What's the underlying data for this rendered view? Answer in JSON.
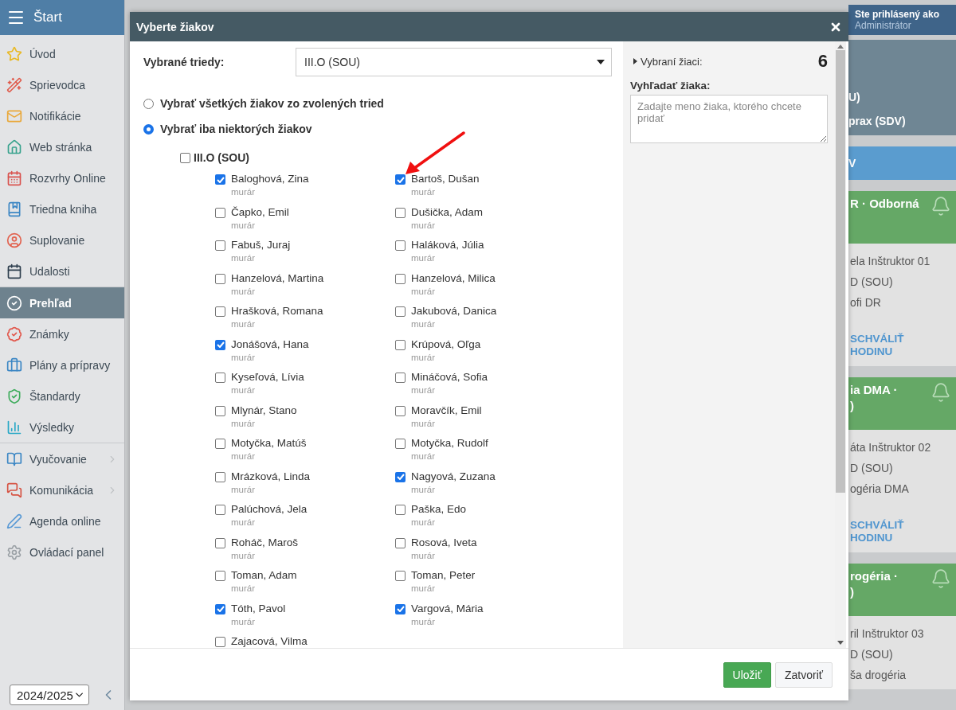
{
  "topbar": {
    "title": "Štart"
  },
  "sidebar": {
    "groups": [
      {
        "items": [
          {
            "label": "Úvod",
            "selected": false,
            "has_submenu": false
          },
          {
            "label": "Sprievodca",
            "selected": false,
            "has_submenu": false
          },
          {
            "label": "Notifikácie",
            "selected": false,
            "has_submenu": false
          },
          {
            "label": "Web stránka",
            "selected": false,
            "has_submenu": false
          },
          {
            "label": "Rozvrhy Online",
            "selected": false,
            "has_submenu": false
          },
          {
            "label": "Triedna kniha",
            "selected": false,
            "has_submenu": false
          },
          {
            "label": "Suplovanie",
            "selected": false,
            "has_submenu": false
          },
          {
            "label": "Udalosti",
            "selected": false,
            "has_submenu": false
          }
        ]
      },
      {
        "items": [
          {
            "label": "Prehľad",
            "selected": true,
            "has_submenu": false
          },
          {
            "label": "Známky",
            "selected": false,
            "has_submenu": false
          },
          {
            "label": "Plány a prípravy",
            "selected": false,
            "has_submenu": false
          },
          {
            "label": "Štandardy",
            "selected": false,
            "has_submenu": false
          },
          {
            "label": "Výsledky",
            "selected": false,
            "has_submenu": false
          }
        ]
      },
      {
        "items": [
          {
            "label": "Vyučovanie",
            "selected": false,
            "has_submenu": true
          },
          {
            "label": "Komunikácia",
            "selected": false,
            "has_submenu": true
          },
          {
            "label": "Agenda online",
            "selected": false,
            "has_submenu": false
          },
          {
            "label": "Ovládací panel",
            "selected": false,
            "has_submenu": false
          }
        ]
      }
    ],
    "year_select": "2024/2025"
  },
  "user": {
    "caption": "Ste prihlásený ako",
    "name": "Administrátor"
  },
  "cards": [
    {
      "kind": "info",
      "lines": [
        "U)",
        "prax (SDV)"
      ]
    },
    {
      "kind": "banner",
      "lines": [
        "V"
      ]
    },
    {
      "kind": "lesson",
      "title": [
        "R · Odborná"
      ],
      "lines": [
        "ela Inštruktor 01",
        "D (SOU)",
        "ofi DR"
      ],
      "link": "SCHVÁLIŤ HODINU"
    },
    {
      "kind": "lesson",
      "title": [
        "ia DMA ·",
        ")"
      ],
      "lines": [
        "áta Inštruktor 02",
        "D (SOU)",
        "ogéria DMA"
      ],
      "link": "SCHVÁLIŤ HODINU"
    },
    {
      "kind": "lesson",
      "title": [
        "rogéria ·",
        ")"
      ],
      "lines": [
        "ril Inštruktor 03",
        "D (SOU)",
        "ša drogéria"
      ]
    }
  ],
  "dialog": {
    "title": "Vyberte žiakov",
    "class_label": "Vybrané triedy:",
    "class_value": "III.O (SOU)",
    "radios": [
      {
        "label": "Vybrať všetkých žiakov zo zvolených tried",
        "selected": false
      },
      {
        "label": "Vybrať iba niektorých žiakov",
        "selected": true
      }
    ],
    "group": {
      "label": "III.O (SOU)",
      "checked": false
    },
    "students": [
      {
        "name": "Baloghová, Zina",
        "note": "murár",
        "checked": true
      },
      {
        "name": "Bartoš, Dušan",
        "note": "murár",
        "checked": true
      },
      {
        "name": "Čapko, Emil",
        "note": "murár",
        "checked": false
      },
      {
        "name": "Dušička, Adam",
        "note": "murár",
        "checked": false
      },
      {
        "name": "Fabuš, Juraj",
        "note": "murár",
        "checked": false
      },
      {
        "name": "Haláková, Júlia",
        "note": "murár",
        "checked": false
      },
      {
        "name": "Hanzelová, Martina",
        "note": "murár",
        "checked": false
      },
      {
        "name": "Hanzelová, Milica",
        "note": "murár",
        "checked": false
      },
      {
        "name": "Hrašková, Romana",
        "note": "murár",
        "checked": false
      },
      {
        "name": "Jakubová, Danica",
        "note": "murár",
        "checked": false
      },
      {
        "name": "Jonášová, Hana",
        "note": "murár",
        "checked": true
      },
      {
        "name": "Krúpová, Oľga",
        "note": "murár",
        "checked": false
      },
      {
        "name": "Kyseľová, Lívia",
        "note": "murár",
        "checked": false
      },
      {
        "name": "Mináčová, Sofia",
        "note": "murár",
        "checked": false
      },
      {
        "name": "Mlynár, Stano",
        "note": "murár",
        "checked": false
      },
      {
        "name": "Moravčík, Emil",
        "note": "murár",
        "checked": false
      },
      {
        "name": "Motyčka, Matúš",
        "note": "murár",
        "checked": false
      },
      {
        "name": "Motyčka, Rudolf",
        "note": "murár",
        "checked": false
      },
      {
        "name": "Mrázková, Linda",
        "note": "murár",
        "checked": false
      },
      {
        "name": "Nagyová, Zuzana",
        "note": "murár",
        "checked": true
      },
      {
        "name": "Palúchová, Jela",
        "note": "murár",
        "checked": false
      },
      {
        "name": "Paška, Edo",
        "note": "murár",
        "checked": false
      },
      {
        "name": "Roháč, Maroš",
        "note": "murár",
        "checked": false
      },
      {
        "name": "Rosová, Iveta",
        "note": "murár",
        "checked": false
      },
      {
        "name": "Toman, Adam",
        "note": "murár",
        "checked": false
      },
      {
        "name": "Toman, Peter",
        "note": "murár",
        "checked": false
      },
      {
        "name": "Tóth, Pavol",
        "note": "murár",
        "checked": true
      },
      {
        "name": "Vargová, Mária",
        "note": "murár",
        "checked": true
      },
      {
        "name": "Zajacová, Vilma",
        "checked": false
      }
    ],
    "selected_label": "Vybraní žiaci:",
    "selected_count": "6",
    "search_label": "Vyhľadať žiaka:",
    "search_placeholder": "Zadajte meno žiaka, ktorého chcete pridať",
    "buttons": [
      {
        "kind": "primary",
        "label": "Uložiť"
      },
      {
        "kind": "secondary",
        "label": "Zatvoriť"
      }
    ]
  }
}
